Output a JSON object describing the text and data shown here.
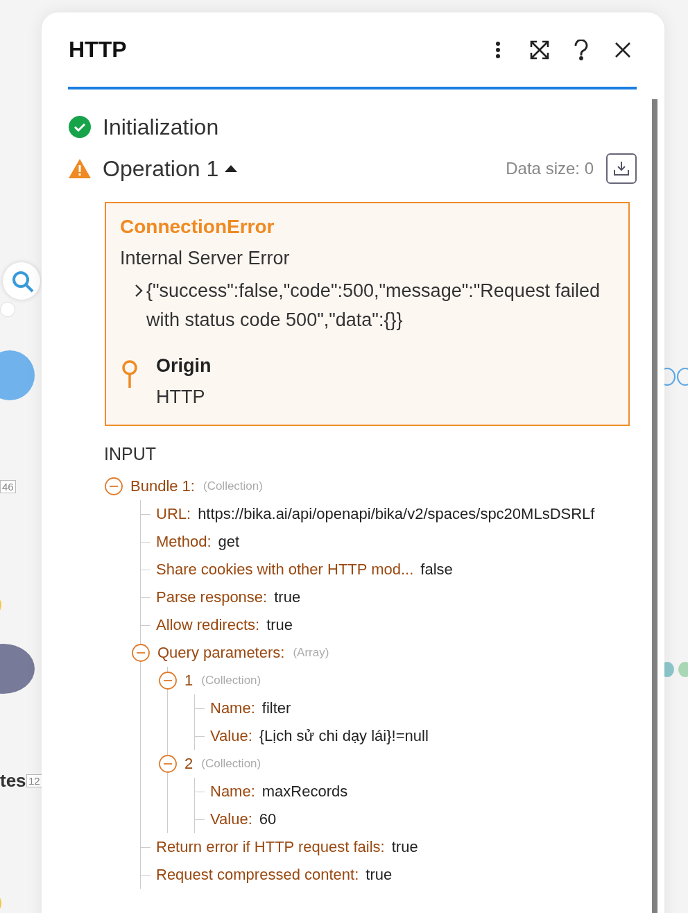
{
  "canvas": {
    "labels": [
      {
        "kind": "count",
        "text": "46"
      },
      {
        "kind": "name",
        "text": "tes"
      },
      {
        "kind": "count",
        "text": "12"
      }
    ]
  },
  "window": {
    "title": "HTTP"
  },
  "steps": [
    {
      "kind": "success",
      "label": "Initialization"
    },
    {
      "kind": "warning",
      "label": "Operation 1",
      "expanded": true,
      "data_size": "Data size: 0"
    }
  ],
  "error": {
    "title": "ConnectionError",
    "message": "Internal Server Error",
    "detail": "{\"success\":false,\"code\":500,\"message\":\"Request failed with status code 500\",\"data\":{}}",
    "origin_label": "Origin",
    "origin_value": "HTTP"
  },
  "input": {
    "heading": "INPUT",
    "tree": [
      {
        "key": "Bundle 1:",
        "type": "(Collection)",
        "expanded": true,
        "children": [
          {
            "key": "URL:",
            "value": "https://bika.ai/api/openapi/bika/v2/spaces/spc20MLsDSRLf"
          },
          {
            "key": "Method:",
            "value": "get"
          },
          {
            "key": "Share cookies with other HTTP mod...",
            "value": "false"
          },
          {
            "key": "Parse response:",
            "value": "true"
          },
          {
            "key": "Allow redirects:",
            "value": "true"
          },
          {
            "key": "Query parameters:",
            "type": "(Array)",
            "expanded": true,
            "children": [
              {
                "key": "1",
                "type": "(Collection)",
                "expanded": true,
                "children": [
                  {
                    "key": "Name:",
                    "value": "filter"
                  },
                  {
                    "key": "Value:",
                    "value": "{Lịch sử chi dạy lái}!=null"
                  }
                ]
              },
              {
                "key": "2",
                "type": "(Collection)",
                "expanded": true,
                "children": [
                  {
                    "key": "Name:",
                    "value": "maxRecords"
                  },
                  {
                    "key": "Value:",
                    "value": "60"
                  }
                ]
              }
            ]
          },
          {
            "key": "Return error if HTTP request fails:",
            "value": "true"
          },
          {
            "key": "Request compressed content:",
            "value": "true"
          }
        ]
      }
    ]
  }
}
